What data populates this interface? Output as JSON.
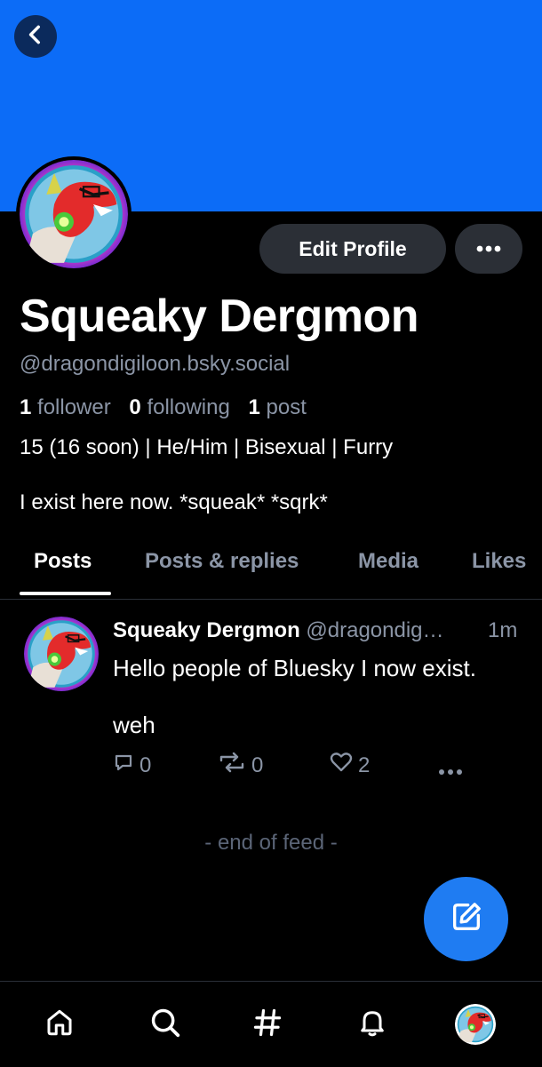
{
  "profile": {
    "name": "Squeaky Dergmon",
    "handle": "@dragondigiloon.bsky.social",
    "followers_count": "1",
    "followers_label": "follower",
    "following_count": "0",
    "following_label": "following",
    "posts_count": "1",
    "posts_label": "post",
    "description": "15 (16 soon) | He/Him | Bisexual | Furry",
    "bio": "I exist here now. *squeak* *sqrk*",
    "banner_color": "#0c6cf7"
  },
  "buttons": {
    "edit_profile": "Edit Profile"
  },
  "tabs": [
    {
      "label": "Posts",
      "active": true
    },
    {
      "label": "Posts & replies",
      "active": false
    },
    {
      "label": "Media",
      "active": false
    },
    {
      "label": "Likes",
      "active": false
    }
  ],
  "post": {
    "author": "Squeaky Dergmon",
    "handle": "@dragondig…",
    "time": "1m",
    "text": "Hello people of Bluesky I now exist.\n\nweh",
    "replies": "0",
    "reposts": "0",
    "likes": "2"
  },
  "feed": {
    "end_text": "- end of feed -"
  },
  "nav": {
    "items": [
      "home-icon",
      "search-icon",
      "hashtag-icon",
      "bell-icon",
      "profile-avatar"
    ]
  },
  "colors": {
    "accent": "#1f7cf2",
    "muted": "#8b95a6",
    "button_bg": "#2b2f36"
  }
}
